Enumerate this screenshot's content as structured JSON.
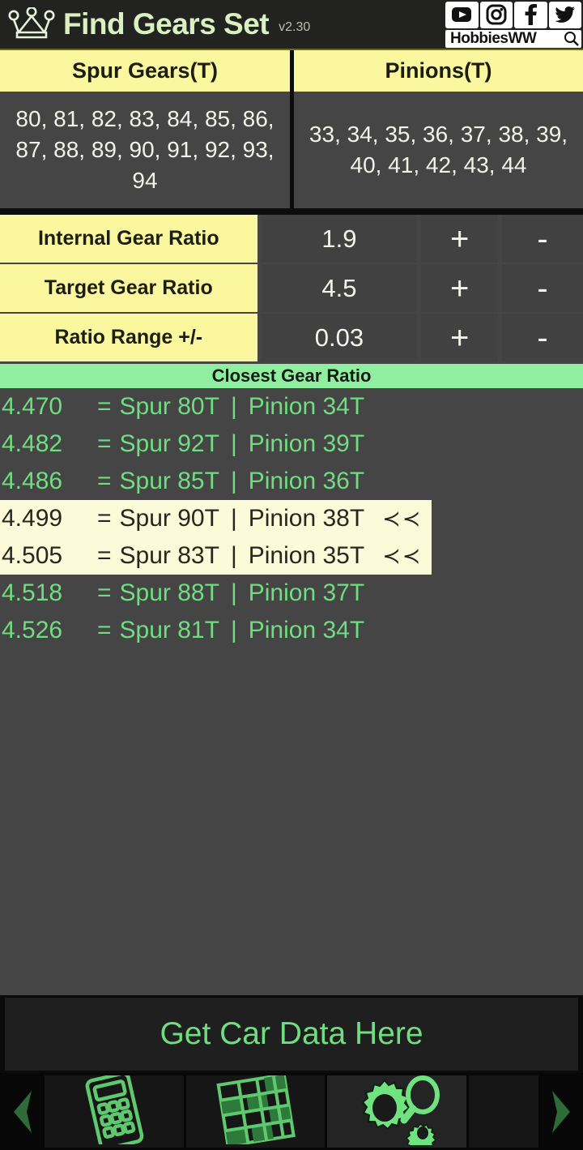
{
  "header": {
    "logo_icon": "crown-icon",
    "title": "Find Gears Set",
    "version": "v2.30",
    "social": [
      {
        "name": "youtube-icon",
        "label": "YouTube"
      },
      {
        "name": "instagram-icon",
        "label": "Instagram"
      },
      {
        "name": "facebook-icon",
        "label": "Facebook"
      },
      {
        "name": "twitter-icon",
        "label": "Twitter"
      }
    ],
    "brand": "HobbiesWW",
    "search_icon": "search-icon"
  },
  "gear_pool": {
    "spur": {
      "header": "Spur Gears(T)",
      "values": "80, 81, 82, 83, 84, 85, 86, 87, 88, 89, 90, 91, 92, 93, 94"
    },
    "pinion": {
      "header": "Pinions(T)",
      "values": "33, 34, 35, 36, 37, 38, 39, 40, 41, 42, 43, 44"
    }
  },
  "inputs": [
    {
      "label": "Internal Gear Ratio",
      "value": "1.9",
      "plus": "+",
      "minus": "-"
    },
    {
      "label": "Target Gear Ratio",
      "value": "4.5",
      "plus": "+",
      "minus": "-"
    },
    {
      "label": "Ratio Range +/-",
      "value": "0.03",
      "plus": "+",
      "minus": "-"
    }
  ],
  "results": {
    "banner": "Closest Gear Ratio",
    "rows": [
      {
        "ratio": "4.470",
        "eq": "=",
        "spur": "Spur 80T",
        "sep": "|",
        "pinion": "Pinion 34T",
        "mark": "",
        "highlight": false
      },
      {
        "ratio": "4.482",
        "eq": "=",
        "spur": "Spur 92T",
        "sep": "|",
        "pinion": "Pinion 39T",
        "mark": "",
        "highlight": false
      },
      {
        "ratio": "4.486",
        "eq": "=",
        "spur": "Spur 85T",
        "sep": "|",
        "pinion": "Pinion 36T",
        "mark": "",
        "highlight": false
      },
      {
        "ratio": "4.499",
        "eq": "=",
        "spur": "Spur 90T",
        "sep": "|",
        "pinion": "Pinion 38T",
        "mark": "≺≺",
        "highlight": true
      },
      {
        "ratio": "4.505",
        "eq": "=",
        "spur": "Spur 83T",
        "sep": "|",
        "pinion": "Pinion 35T",
        "mark": "≺≺",
        "highlight": true
      },
      {
        "ratio": "4.518",
        "eq": "=",
        "spur": "Spur 88T",
        "sep": "|",
        "pinion": "Pinion 37T",
        "mark": "",
        "highlight": false
      },
      {
        "ratio": "4.526",
        "eq": "=",
        "spur": "Spur 81T",
        "sep": "|",
        "pinion": "Pinion 34T",
        "mark": "",
        "highlight": false
      }
    ]
  },
  "cta": {
    "label": "Get Car Data Here"
  },
  "bottom_nav": {
    "left_arrow_icon": "chevron-left-icon",
    "right_arrow_icon": "chevron-right-icon",
    "tabs": [
      {
        "name": "calculator-icon",
        "active": false
      },
      {
        "name": "grid-table-icon",
        "active": false
      },
      {
        "name": "gears-search-icon",
        "active": true
      },
      {
        "name": "next-tab-partial",
        "active": false
      }
    ]
  },
  "colors": {
    "accent_yellow": "#faf79f",
    "accent_green": "#90eea0",
    "text_green": "#6fdd80",
    "background_dark": "#454545",
    "highlight_cream": "#fbfbd9"
  }
}
